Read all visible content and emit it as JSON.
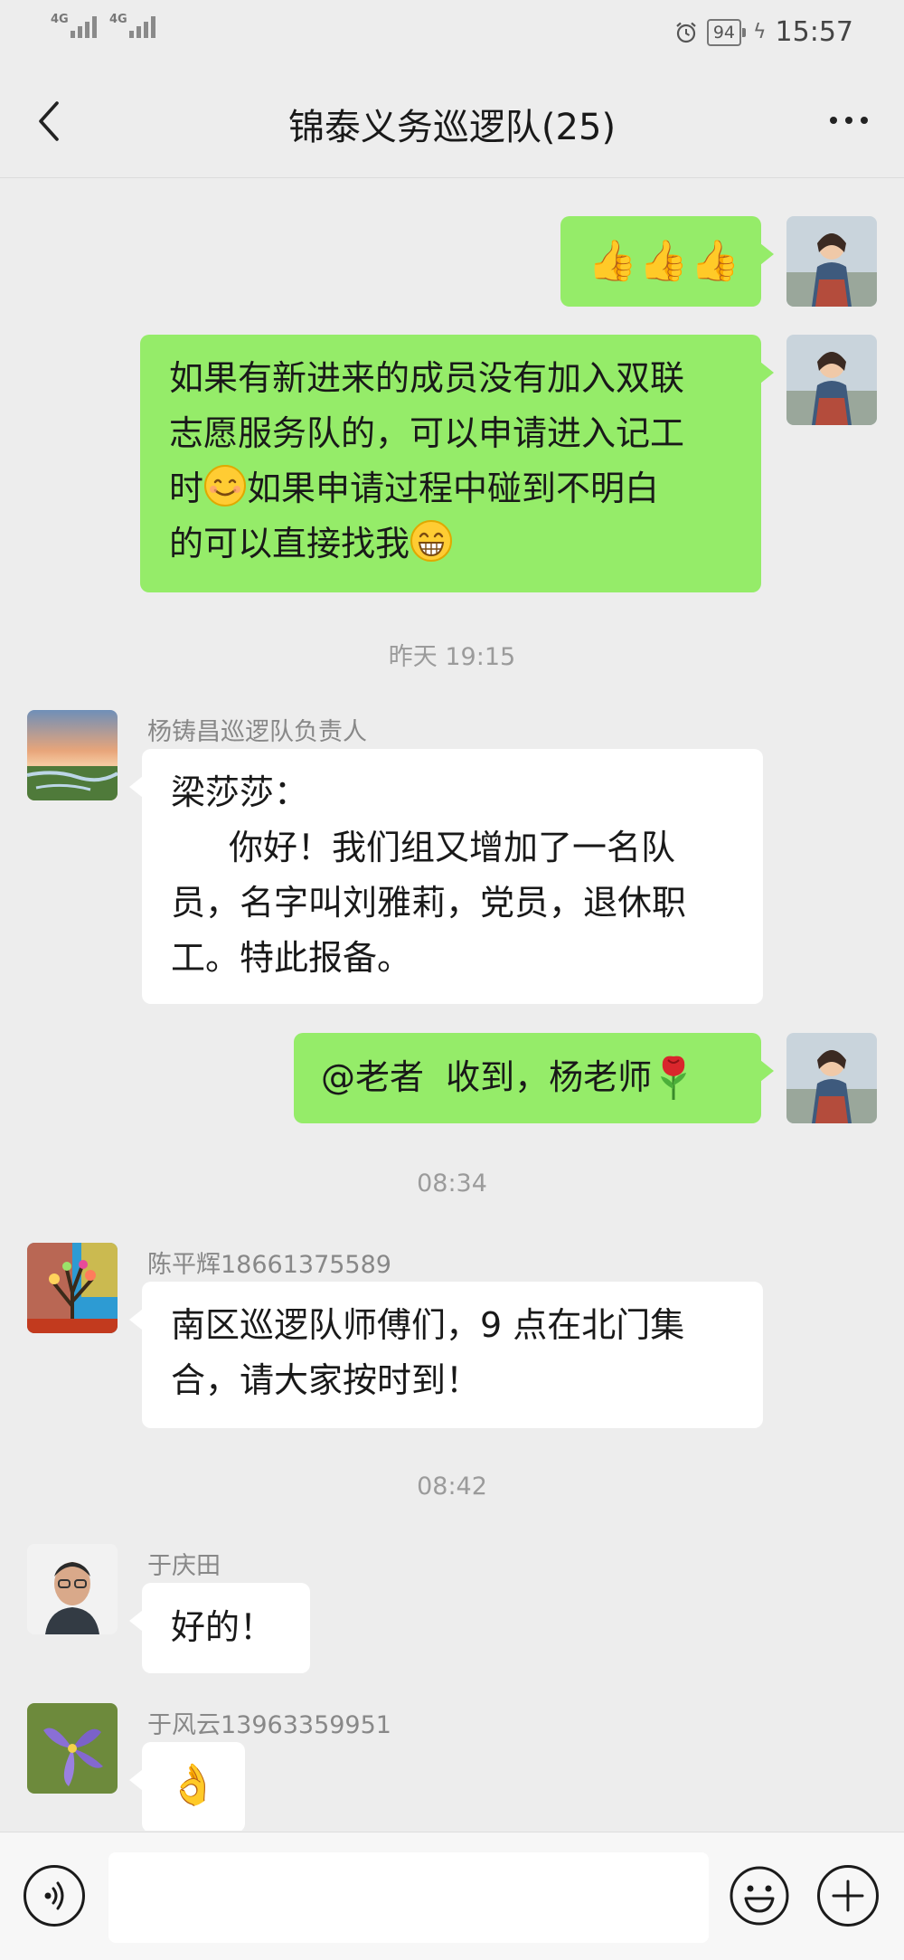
{
  "status_bar": {
    "network_1": "4G",
    "network_2": "4G",
    "battery": "94",
    "time": "15:57"
  },
  "header": {
    "title": "锦泰义务巡逻队(25)"
  },
  "messages": {
    "m1": {
      "sender": "me",
      "content": "👍👍👍"
    },
    "m2": {
      "sender": "me",
      "line1": "如果有新进来的成员没有加入双联",
      "line2": "志愿服务队的，可以申请进入记工",
      "line3a": "时",
      "line3b": "如果申请过程中碰到不明白",
      "line4": "的可以直接找我"
    },
    "ts1": "昨天 19:15",
    "m3": {
      "name": "杨铸昌巡逻队负责人",
      "line1": "梁莎莎：",
      "line2": "你好！我们组又增加了一名队",
      "line3": "员，名字叫刘雅莉，党员，退休职",
      "line4": "工。特此报备。"
    },
    "m4": {
      "sender": "me",
      "content": "@老者  收到，杨老师"
    },
    "ts2": "08:34",
    "m5": {
      "name": "陈平辉18661375589",
      "line1": "南区巡逻队师傅们，9 点在北门集",
      "line2": "合，请大家按时到！"
    },
    "ts3": "08:42",
    "m6": {
      "name": "于庆田",
      "content": "好的！"
    },
    "m7": {
      "name": "于风云13963359951",
      "content": "👌"
    }
  },
  "icons": {
    "back": "chevron-left-icon",
    "more": "more-dots-icon",
    "voice": "voice-icon",
    "emoji": "emoji-icon",
    "plus": "plus-icon"
  },
  "colors": {
    "my_bubble": "#95ec69",
    "other_bubble": "#ffffff",
    "background": "#ededed"
  }
}
